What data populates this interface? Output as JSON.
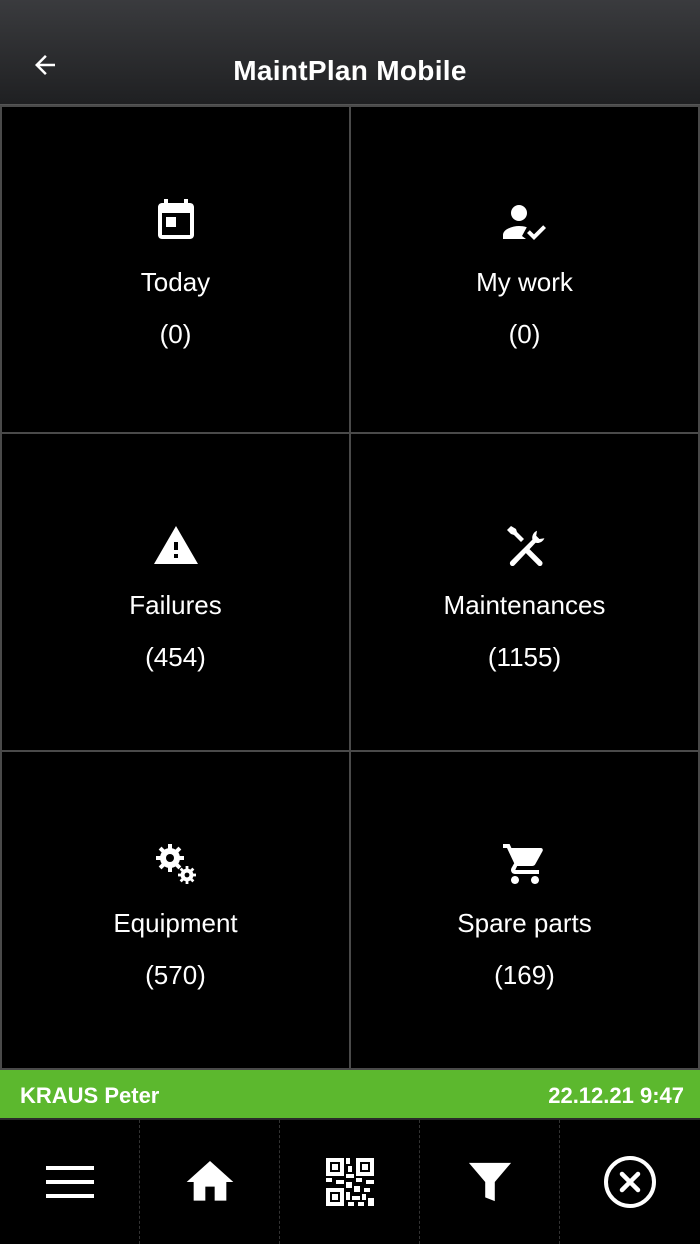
{
  "header": {
    "title": "MaintPlan Mobile",
    "back_icon": "arrow-left-icon"
  },
  "tiles": [
    {
      "label": "Today",
      "count": "(0)",
      "icon": "calendar-icon"
    },
    {
      "label": "My work",
      "count": "(0)",
      "icon": "user-check-icon"
    },
    {
      "label": "Failures",
      "count": "(454)",
      "icon": "warning-icon"
    },
    {
      "label": "Maintenances",
      "count": "(1155)",
      "icon": "tools-icon"
    },
    {
      "label": "Equipment",
      "count": "(570)",
      "icon": "gears-icon"
    },
    {
      "label": "Spare parts",
      "count": "(169)",
      "icon": "cart-icon"
    }
  ],
  "status_bar": {
    "user": "KRAUS Peter",
    "datetime": "22.12.21 9:47",
    "color": "#5cb82e"
  },
  "bottom_nav": [
    {
      "icon": "menu-icon"
    },
    {
      "icon": "home-icon"
    },
    {
      "icon": "qr-code-icon"
    },
    {
      "icon": "filter-icon"
    },
    {
      "icon": "close-circle-icon"
    }
  ]
}
